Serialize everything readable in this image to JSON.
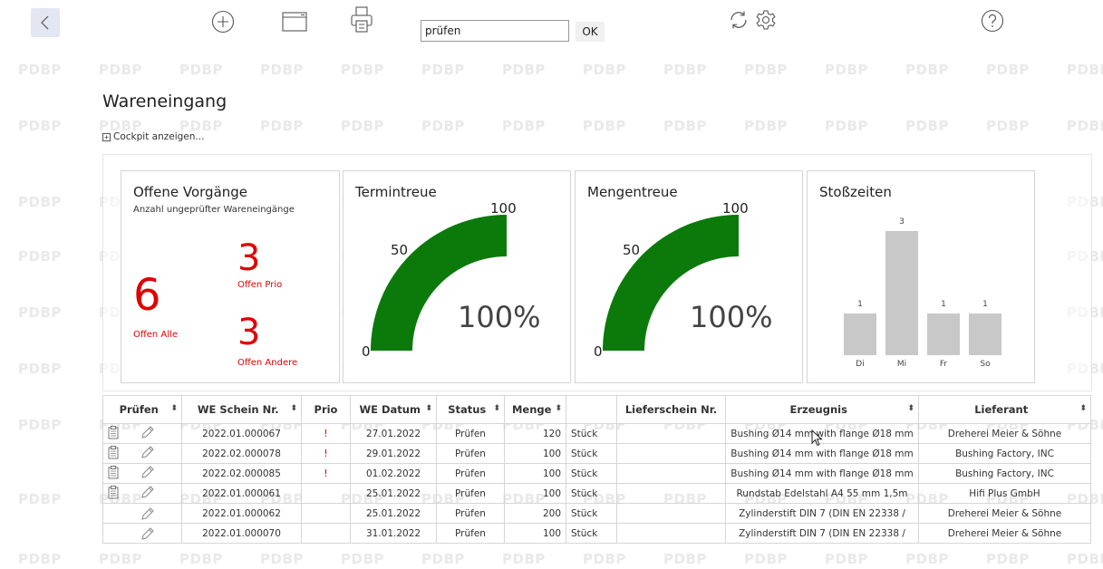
{
  "toolbar": {
    "search_value": "prüfen",
    "ok_label": "OK"
  },
  "watermark": "PDBP",
  "page": {
    "title": "Wareneingang",
    "cockpit_toggle": "Cockpit anzeigen..."
  },
  "cards": {
    "offene": {
      "title": "Offene Vorgänge",
      "subtitle": "Anzahl ungeprüfter Wareneingänge",
      "all_value": "6",
      "all_label": "Offen Alle",
      "prio_value": "3",
      "prio_label": "Offen Prio",
      "andere_value": "3",
      "andere_label": "Offen Andere"
    },
    "termintreue": {
      "title": "Termintreue",
      "value": 100,
      "pct": "100%",
      "t0": "0",
      "t50": "50",
      "t100": "100"
    },
    "mengentreue": {
      "title": "Mengentreue",
      "value": 100,
      "pct": "100%",
      "t0": "0",
      "t50": "50",
      "t100": "100"
    },
    "stosszeiten": {
      "title": "Stoßzeiten"
    }
  },
  "chart_data": {
    "type": "bar",
    "title": "Stoßzeiten",
    "categories": [
      "Di",
      "Mi",
      "Fr",
      "So"
    ],
    "values": [
      1,
      3,
      1,
      1
    ]
  },
  "colors": {
    "gauge": "#0b7a0b",
    "alert": "#e00000",
    "bar": "#c8c8c8"
  },
  "table": {
    "headers": [
      "Prüfen",
      "WE Schein Nr.",
      "Prio",
      "WE Datum",
      "Status",
      "Menge",
      "",
      "Lieferschein Nr.",
      "Erzeugnis",
      "Lieferant"
    ],
    "rows": [
      {
        "doc": true,
        "we": "2022.01.000067",
        "prio": "!",
        "datum": "27.01.2022",
        "status": "Prüfen",
        "menge": "120",
        "einheit": "Stück",
        "ls": "",
        "erzeugnis": "Bushing Ø14 mm with flange Ø18 mm",
        "lieferant": "Dreherei Meier & Söhne"
      },
      {
        "doc": true,
        "we": "2022.02.000078",
        "prio": "!",
        "datum": "29.01.2022",
        "status": "Prüfen",
        "menge": "100",
        "einheit": "Stück",
        "ls": "",
        "erzeugnis": "Bushing Ø14 mm with flange Ø18 mm",
        "lieferant": "Bushing Factory, INC"
      },
      {
        "doc": true,
        "we": "2022.02.000085",
        "prio": "!",
        "datum": "01.02.2022",
        "status": "Prüfen",
        "menge": "100",
        "einheit": "Stück",
        "ls": "",
        "erzeugnis": "Bushing Ø14 mm with flange Ø18 mm",
        "lieferant": "Bushing Factory, INC"
      },
      {
        "doc": true,
        "we": "2022.01.000061",
        "prio": "",
        "datum": "25.01.2022",
        "status": "Prüfen",
        "menge": "100",
        "einheit": "Stück",
        "ls": "",
        "erzeugnis": "Rundstab Edelstahl A4 55 mm 1,5m",
        "lieferant": "Hifi Plus GmbH"
      },
      {
        "doc": false,
        "we": "2022.01.000062",
        "prio": "",
        "datum": "25.01.2022",
        "status": "Prüfen",
        "menge": "200",
        "einheit": "Stück",
        "ls": "",
        "erzeugnis": "Zylinderstift DIN 7 (DIN EN 22338 /",
        "lieferant": "Dreherei Meier & Söhne"
      },
      {
        "doc": false,
        "we": "2022.01.000070",
        "prio": "",
        "datum": "31.01.2022",
        "status": "Prüfen",
        "menge": "100",
        "einheit": "Stück",
        "ls": "",
        "erzeugnis": "Zylinderstift DIN 7 (DIN EN 22338 /",
        "lieferant": "Dreherei Meier & Söhne"
      }
    ]
  }
}
